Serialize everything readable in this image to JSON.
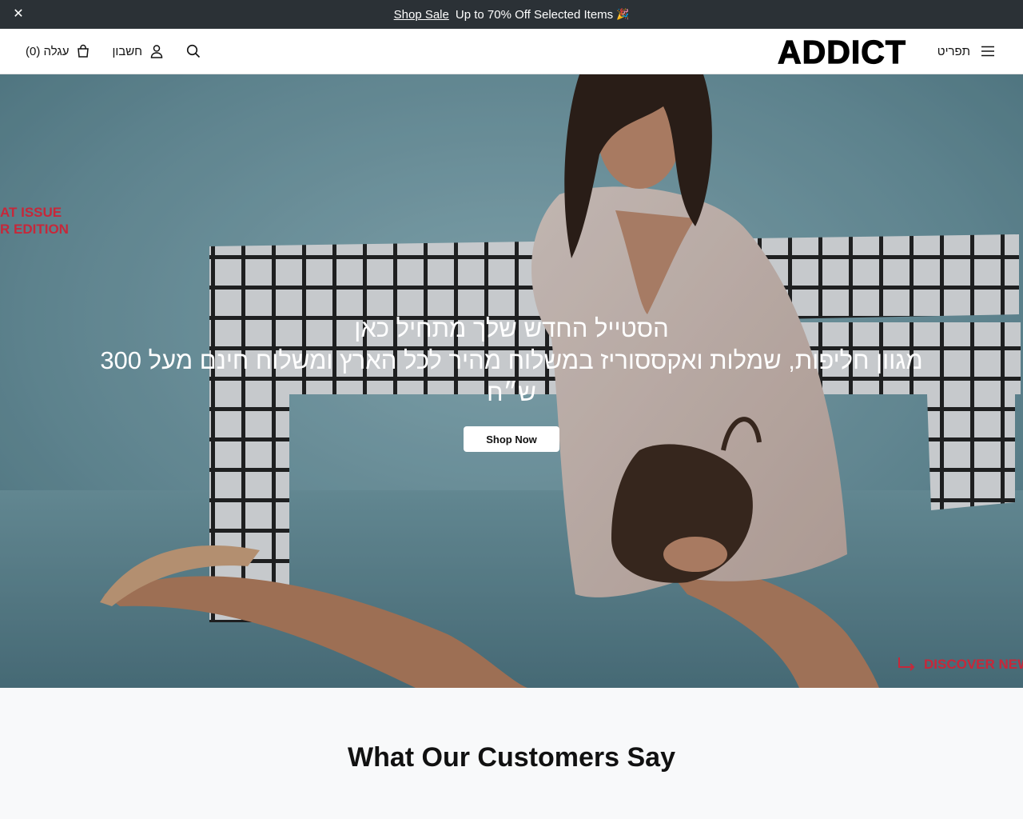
{
  "announcement": {
    "close_icon": "close-icon",
    "link_label": "Shop Sale",
    "text": "Up to 70% Off Selected Items",
    "emoji": "🎉"
  },
  "header": {
    "cart_label": "עגלה (0)",
    "account_label": "חשבון",
    "logo": "ADDICT",
    "menu_label": "תפריט",
    "icons": [
      "bag-icon",
      "user-icon",
      "search-icon",
      "hamburger-icon"
    ]
  },
  "hero": {
    "issue_lines": [
      "AT ISSUE",
      "R EDITION"
    ],
    "title": "הסטייל החדש שלך מתחיל כאן",
    "subtitle": "מגוון חליפות, שמלות ואקססוריז במשלוח מהיר לכל הארץ ומשלוח חינם מעל 300 ש״ח",
    "button_label": "Shop Now",
    "discover_label": "DISCOVER NEW",
    "accent_color": "#c6283a"
  },
  "testimonials": {
    "heading": "What Our Customers Say"
  }
}
